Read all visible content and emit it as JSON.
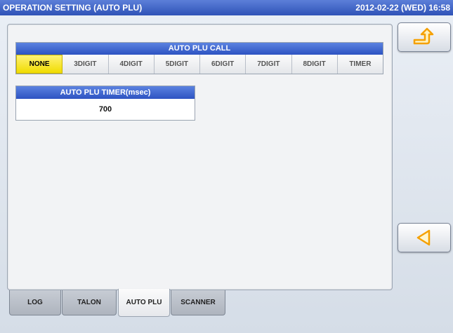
{
  "titlebar": {
    "title": "OPERATION SETTING (AUTO PLU)",
    "datetime": "2012-02-22 (WED) 16:58"
  },
  "auto_plu_call": {
    "header": "AUTO PLU CALL",
    "options": [
      "NONE",
      "3DIGIT",
      "4DIGIT",
      "5DIGIT",
      "6DIGIT",
      "7DIGIT",
      "8DIGIT",
      "TIMER"
    ],
    "selected": "NONE"
  },
  "auto_plu_timer": {
    "header": "AUTO PLU TIMER(msec)",
    "value": "700"
  },
  "side_buttons": {
    "return_icon": "return-arrow-icon",
    "back_icon": "left-triangle-icon"
  },
  "tabs": [
    {
      "label": "LOG"
    },
    {
      "label": "TALON"
    },
    {
      "label": "AUTO PLU"
    },
    {
      "label": "SCANNER"
    }
  ],
  "active_tab": "AUTO PLU",
  "colors": {
    "title_blue": "#2f52b7",
    "header_blue": "#2d53c2",
    "selected_yellow": "#f0dc00",
    "accent_orange": "#f5a000"
  }
}
